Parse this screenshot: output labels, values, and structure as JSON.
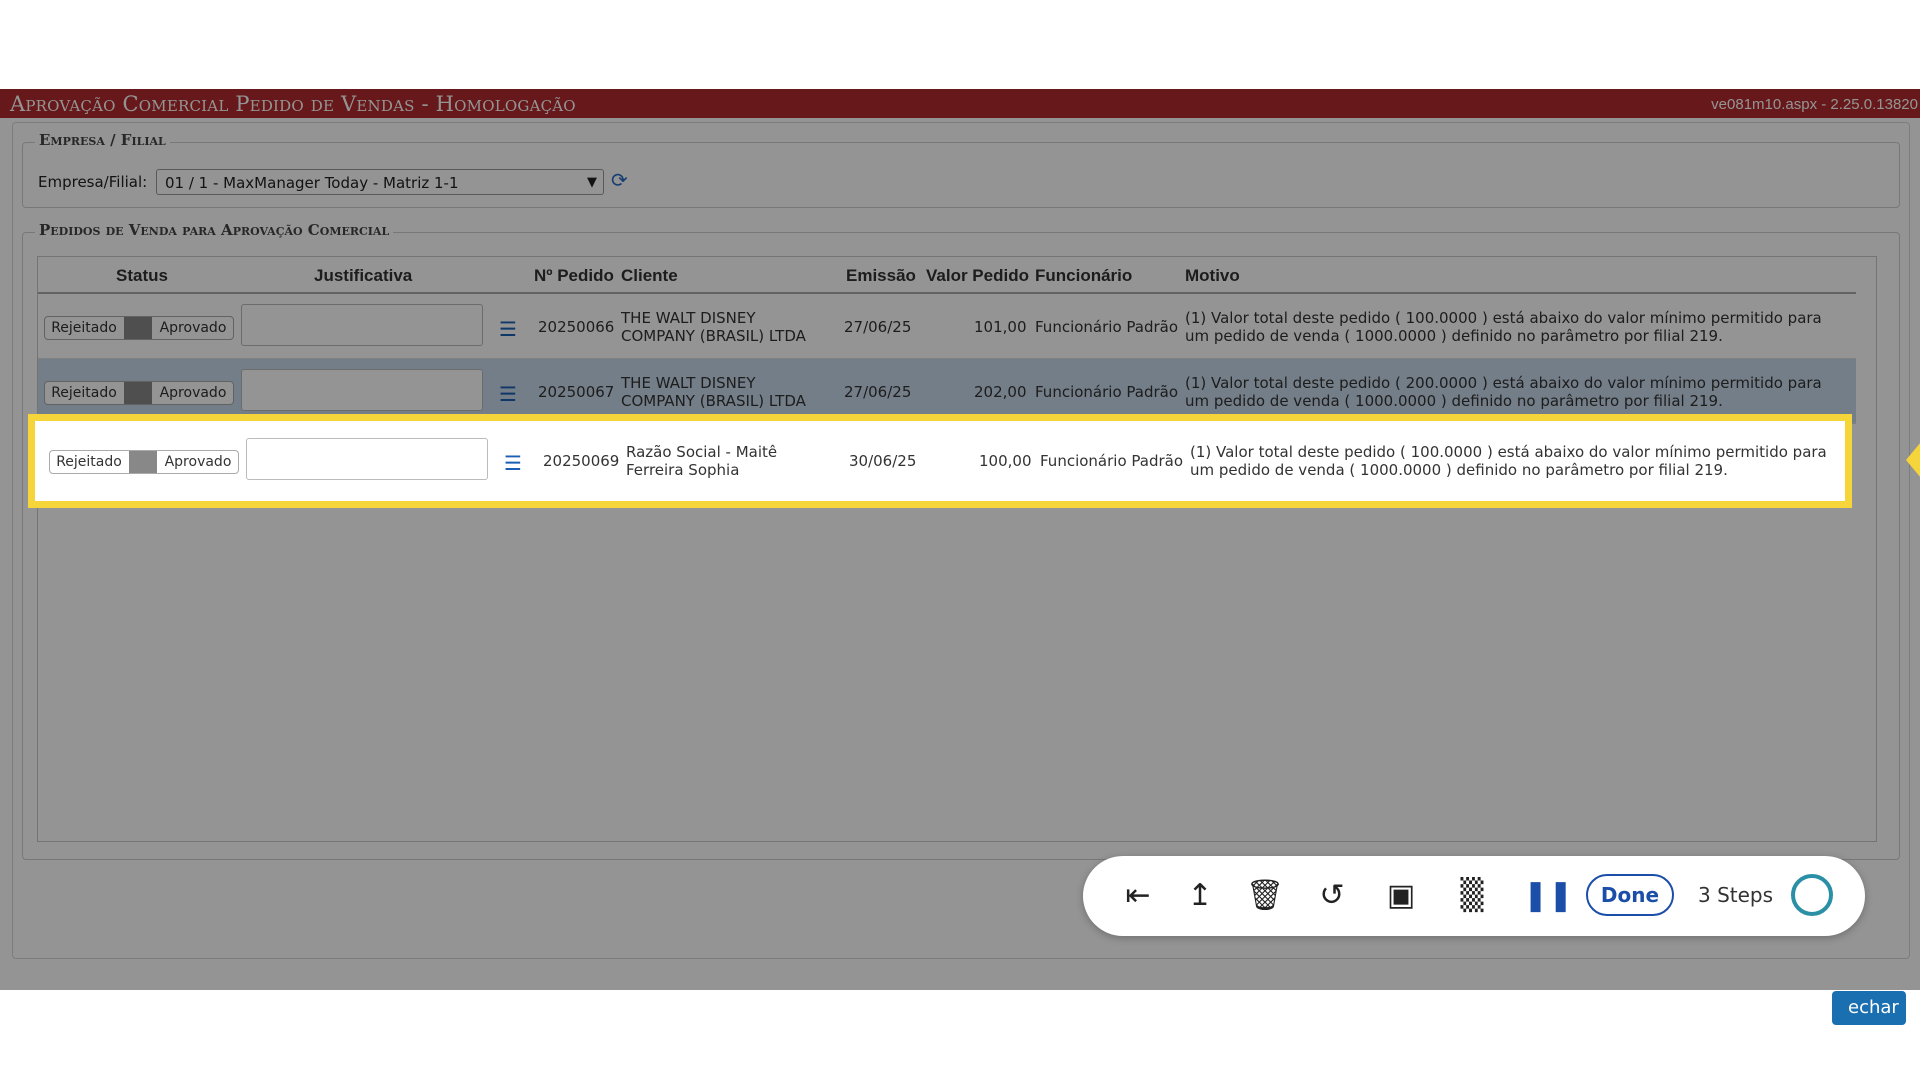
{
  "window": {
    "title": "Aprovação Comercial Pedido de Vendas  - Homologação",
    "version": "ve081m10.aspx - 2.25.0.13820"
  },
  "empresa_section": {
    "legend": "Empresa / Filial",
    "label": "Empresa/Filial:",
    "selected": "01 / 1 - MaxManager Today - Matriz 1-1"
  },
  "pedidos_section": {
    "legend": "Pedidos de Venda para Aprovação Comercial"
  },
  "table": {
    "headers": {
      "status": "Status",
      "justificativa": "Justificativa",
      "pedido": "Nº Pedido",
      "cliente": "Cliente",
      "emissao": "Emissão",
      "valor": "Valor Pedido",
      "funcionario": "Funcionário",
      "motivo": "Motivo"
    },
    "toggle": {
      "rejected": "Rejeitado",
      "approved": "Aprovado"
    },
    "rows": [
      {
        "pedido": "20250066",
        "cliente_l1": "THE WALT DISNEY",
        "cliente_l2": "COMPANY (BRASIL) LTDA",
        "emissao": "27/06/25",
        "valor": "101,00",
        "funcionario": "Funcionário Padrão",
        "motivo_l1": "(1) Valor total deste pedido ( 100.0000 ) está abaixo do valor mínimo permitido para",
        "motivo_l2": "um pedido de venda ( 1000.0000 ) definido no parâmetro por filial 219."
      },
      {
        "pedido": "20250067",
        "cliente_l1": "THE WALT DISNEY",
        "cliente_l2": "COMPANY (BRASIL) LTDA",
        "emissao": "27/06/25",
        "valor": "202,00",
        "funcionario": "Funcionário Padrão",
        "motivo_l1": "(1) Valor total deste pedido ( 200.0000 ) está abaixo do valor mínimo permitido para",
        "motivo_l2": "um pedido de venda ( 1000.0000 ) definido no parâmetro por filial 219."
      },
      {
        "pedido": "20250069",
        "cliente_l1": "Razão Social - Maitê",
        "cliente_l2": "Ferreira Sophia",
        "emissao": "30/06/25",
        "valor": "100,00",
        "funcionario": "Funcionário Padrão",
        "motivo_l1": "(1) Valor total deste pedido ( 100.0000 ) está abaixo do valor mínimo permitido para",
        "motivo_l2": "um pedido de venda ( 1000.0000 ) definido no parâmetro por filial 219."
      }
    ]
  },
  "footer": {
    "fechar_partial": "echar"
  },
  "recorder_toolbar": {
    "done_label": "Done",
    "steps_label": "3 Steps"
  },
  "colors": {
    "titlebar": "#b22a2e",
    "highlight": "#f6d53a",
    "accent": "#1a4ea8"
  }
}
